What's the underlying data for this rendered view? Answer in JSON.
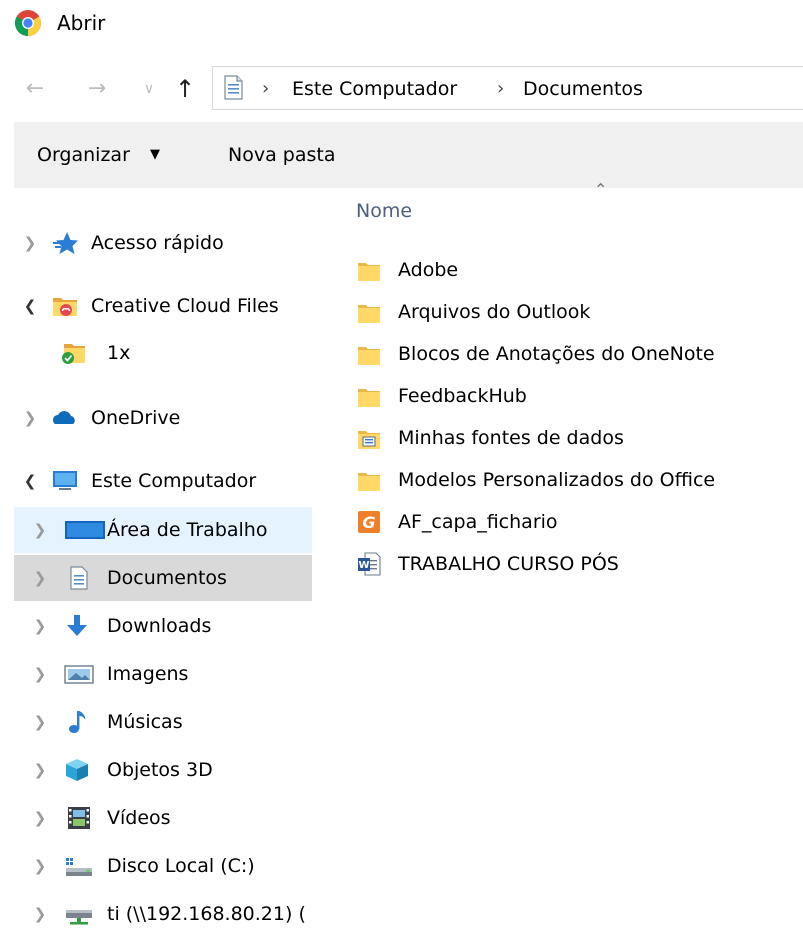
{
  "window": {
    "title": "Abrir"
  },
  "address": {
    "crumbs": [
      "Este Computador",
      "Documentos"
    ],
    "separator": "›"
  },
  "toolbar": {
    "organize_label": "Organizar",
    "new_folder_label": "Nova pasta"
  },
  "nav_pane": {
    "quick_access": "Acesso rápido",
    "creative_cloud": "Creative Cloud Files",
    "cc_child": "1x",
    "onedrive": "OneDrive",
    "this_pc": "Este Computador",
    "desktop": "Área de Trabalho",
    "documents": "Documentos",
    "downloads": "Downloads",
    "pictures": "Imagens",
    "music": "Músicas",
    "objects3d": "Objetos 3D",
    "videos": "Vídeos",
    "local_disk": "Disco Local (C:)",
    "network_drive": "ti (\\\\192.168.80.21) ("
  },
  "content": {
    "column_name": "Nome",
    "files": [
      {
        "name": "Adobe",
        "icon": "folder-icon"
      },
      {
        "name": "Arquivos do Outlook",
        "icon": "folder-icon"
      },
      {
        "name": "Blocos de Anotações do OneNote",
        "icon": "folder-icon"
      },
      {
        "name": "FeedbackHub",
        "icon": "folder-icon"
      },
      {
        "name": "Minhas fontes de dados",
        "icon": "data-sources-folder-icon"
      },
      {
        "name": "Modelos Personalizados do Office",
        "icon": "folder-icon"
      },
      {
        "name": "AF_capa_fichario",
        "icon": "coreldraw-file-icon"
      },
      {
        "name": "TRABALHO CURSO PÓS",
        "icon": "word-document-icon"
      }
    ]
  },
  "colors": {
    "selected_bg": "#d9d9d9",
    "hover_bg": "#e5f3ff",
    "toolbar_bg": "#f0f0f0",
    "column_header": "#4c607a",
    "folder_yellow": "#ffd867"
  }
}
